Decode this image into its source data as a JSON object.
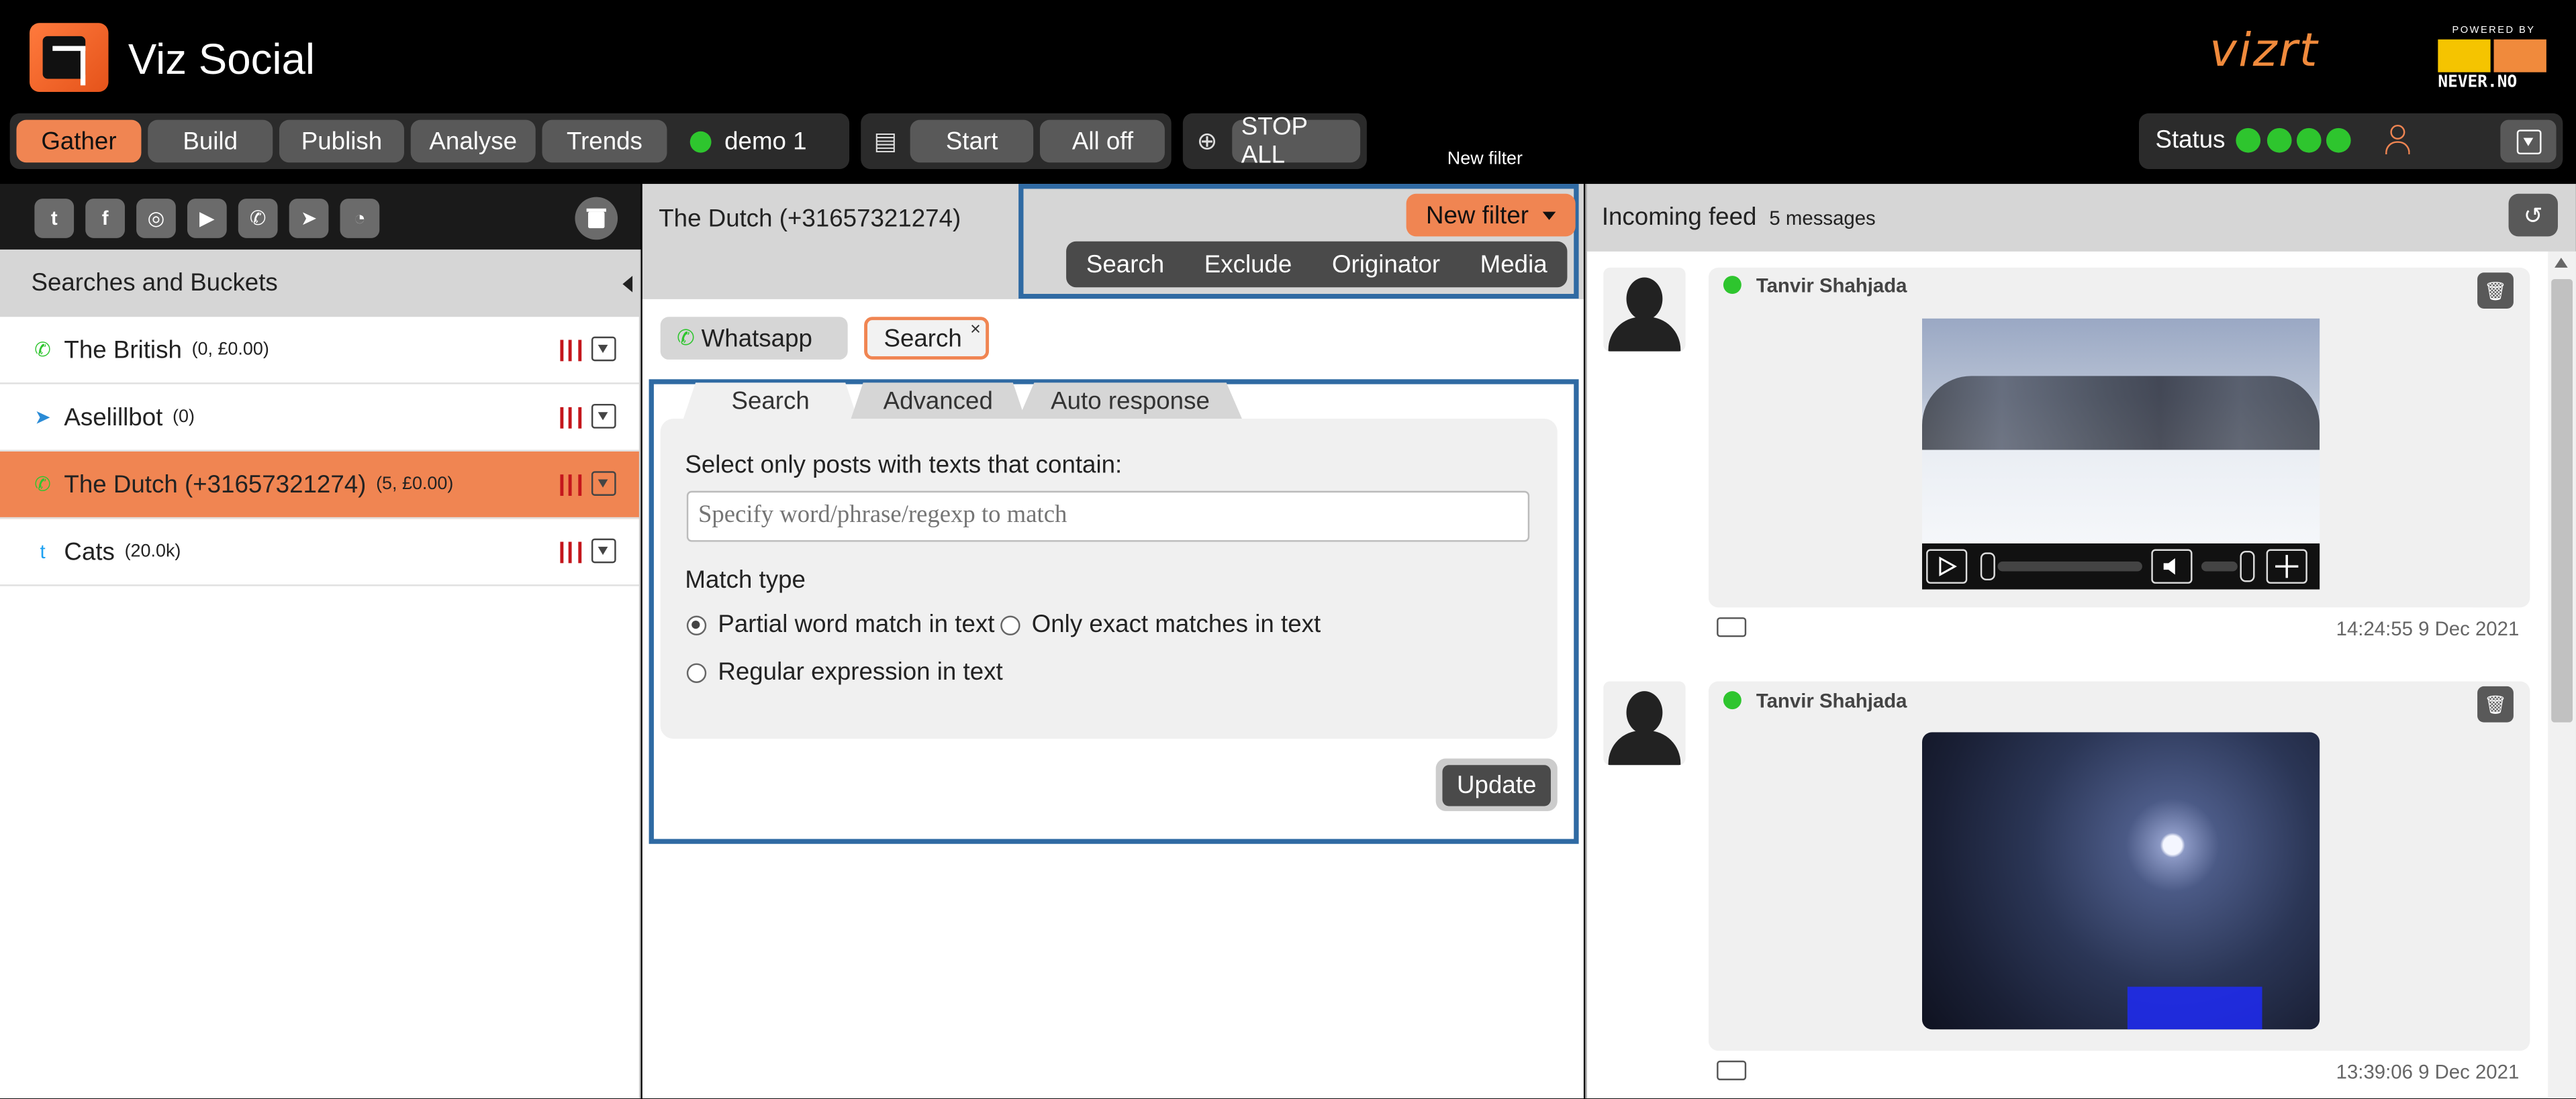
{
  "app": {
    "title": "Viz Social",
    "vizrt_logo": "vizrt",
    "never_logo": {
      "powered_by": "POWERED BY",
      "text": "NEVER.NO"
    }
  },
  "nav": {
    "tabs": [
      "Gather",
      "Build",
      "Publish",
      "Analyse",
      "Trends"
    ],
    "active_tab": "Gather",
    "demo": "demo 1",
    "start": "Start",
    "all_off": "All off",
    "stop_all": "STOP ALL",
    "status_label": "Status",
    "status_color": "#2ec52e"
  },
  "social_icons": [
    "twitter-icon",
    "facebook-icon",
    "instagram-icon",
    "youtube-icon",
    "whatsapp-icon",
    "telegram-icon",
    "rss-icon"
  ],
  "sidebar": {
    "header": "Searches and Buckets",
    "items": [
      {
        "label": "The British",
        "count": "(0, £0.00)",
        "icon": "whatsapp-icon"
      },
      {
        "label": "Aselillbot",
        "count": "(0)",
        "icon": "telegram-icon"
      },
      {
        "label": "The Dutch (+31657321274)",
        "count": "(5, £0.00)",
        "icon": "whatsapp-icon",
        "active": true
      },
      {
        "label": "Cats",
        "count": "(20.0k)",
        "icon": "twitter-icon"
      }
    ]
  },
  "main": {
    "title": "The Dutch (+31657321274)",
    "new_filter_tooltip": "New filter",
    "new_filter": "New filter",
    "filter_types": [
      "Search",
      "Exclude",
      "Originator",
      "Media"
    ],
    "chips": {
      "whatsapp": "Whatsapp",
      "search": "Search",
      "close": "×"
    },
    "tabs": [
      "Search",
      "Advanced",
      "Auto response"
    ],
    "form": {
      "label": "Select only posts with texts that contain:",
      "placeholder": "Specify word/phrase/regexp to match",
      "match_type": "Match type",
      "options": [
        "Partial word match in text",
        "Only exact matches in text",
        "Regular expression in text"
      ],
      "selected": "Partial word match in text"
    },
    "update": "Update"
  },
  "feed": {
    "title": "Incoming feed",
    "count": "5 messages",
    "messages": [
      {
        "author": "Tanvir Shahjada",
        "timestamp": "14:24:55 9 Dec 2021",
        "media": "video"
      },
      {
        "author": "Tanvir Shahjada",
        "timestamp": "13:39:06 9 Dec 2021",
        "media": "image"
      }
    ]
  },
  "colors": {
    "accent": "#f08552",
    "highlight_border": "#2f6aa3",
    "status_green": "#2ec52e"
  }
}
